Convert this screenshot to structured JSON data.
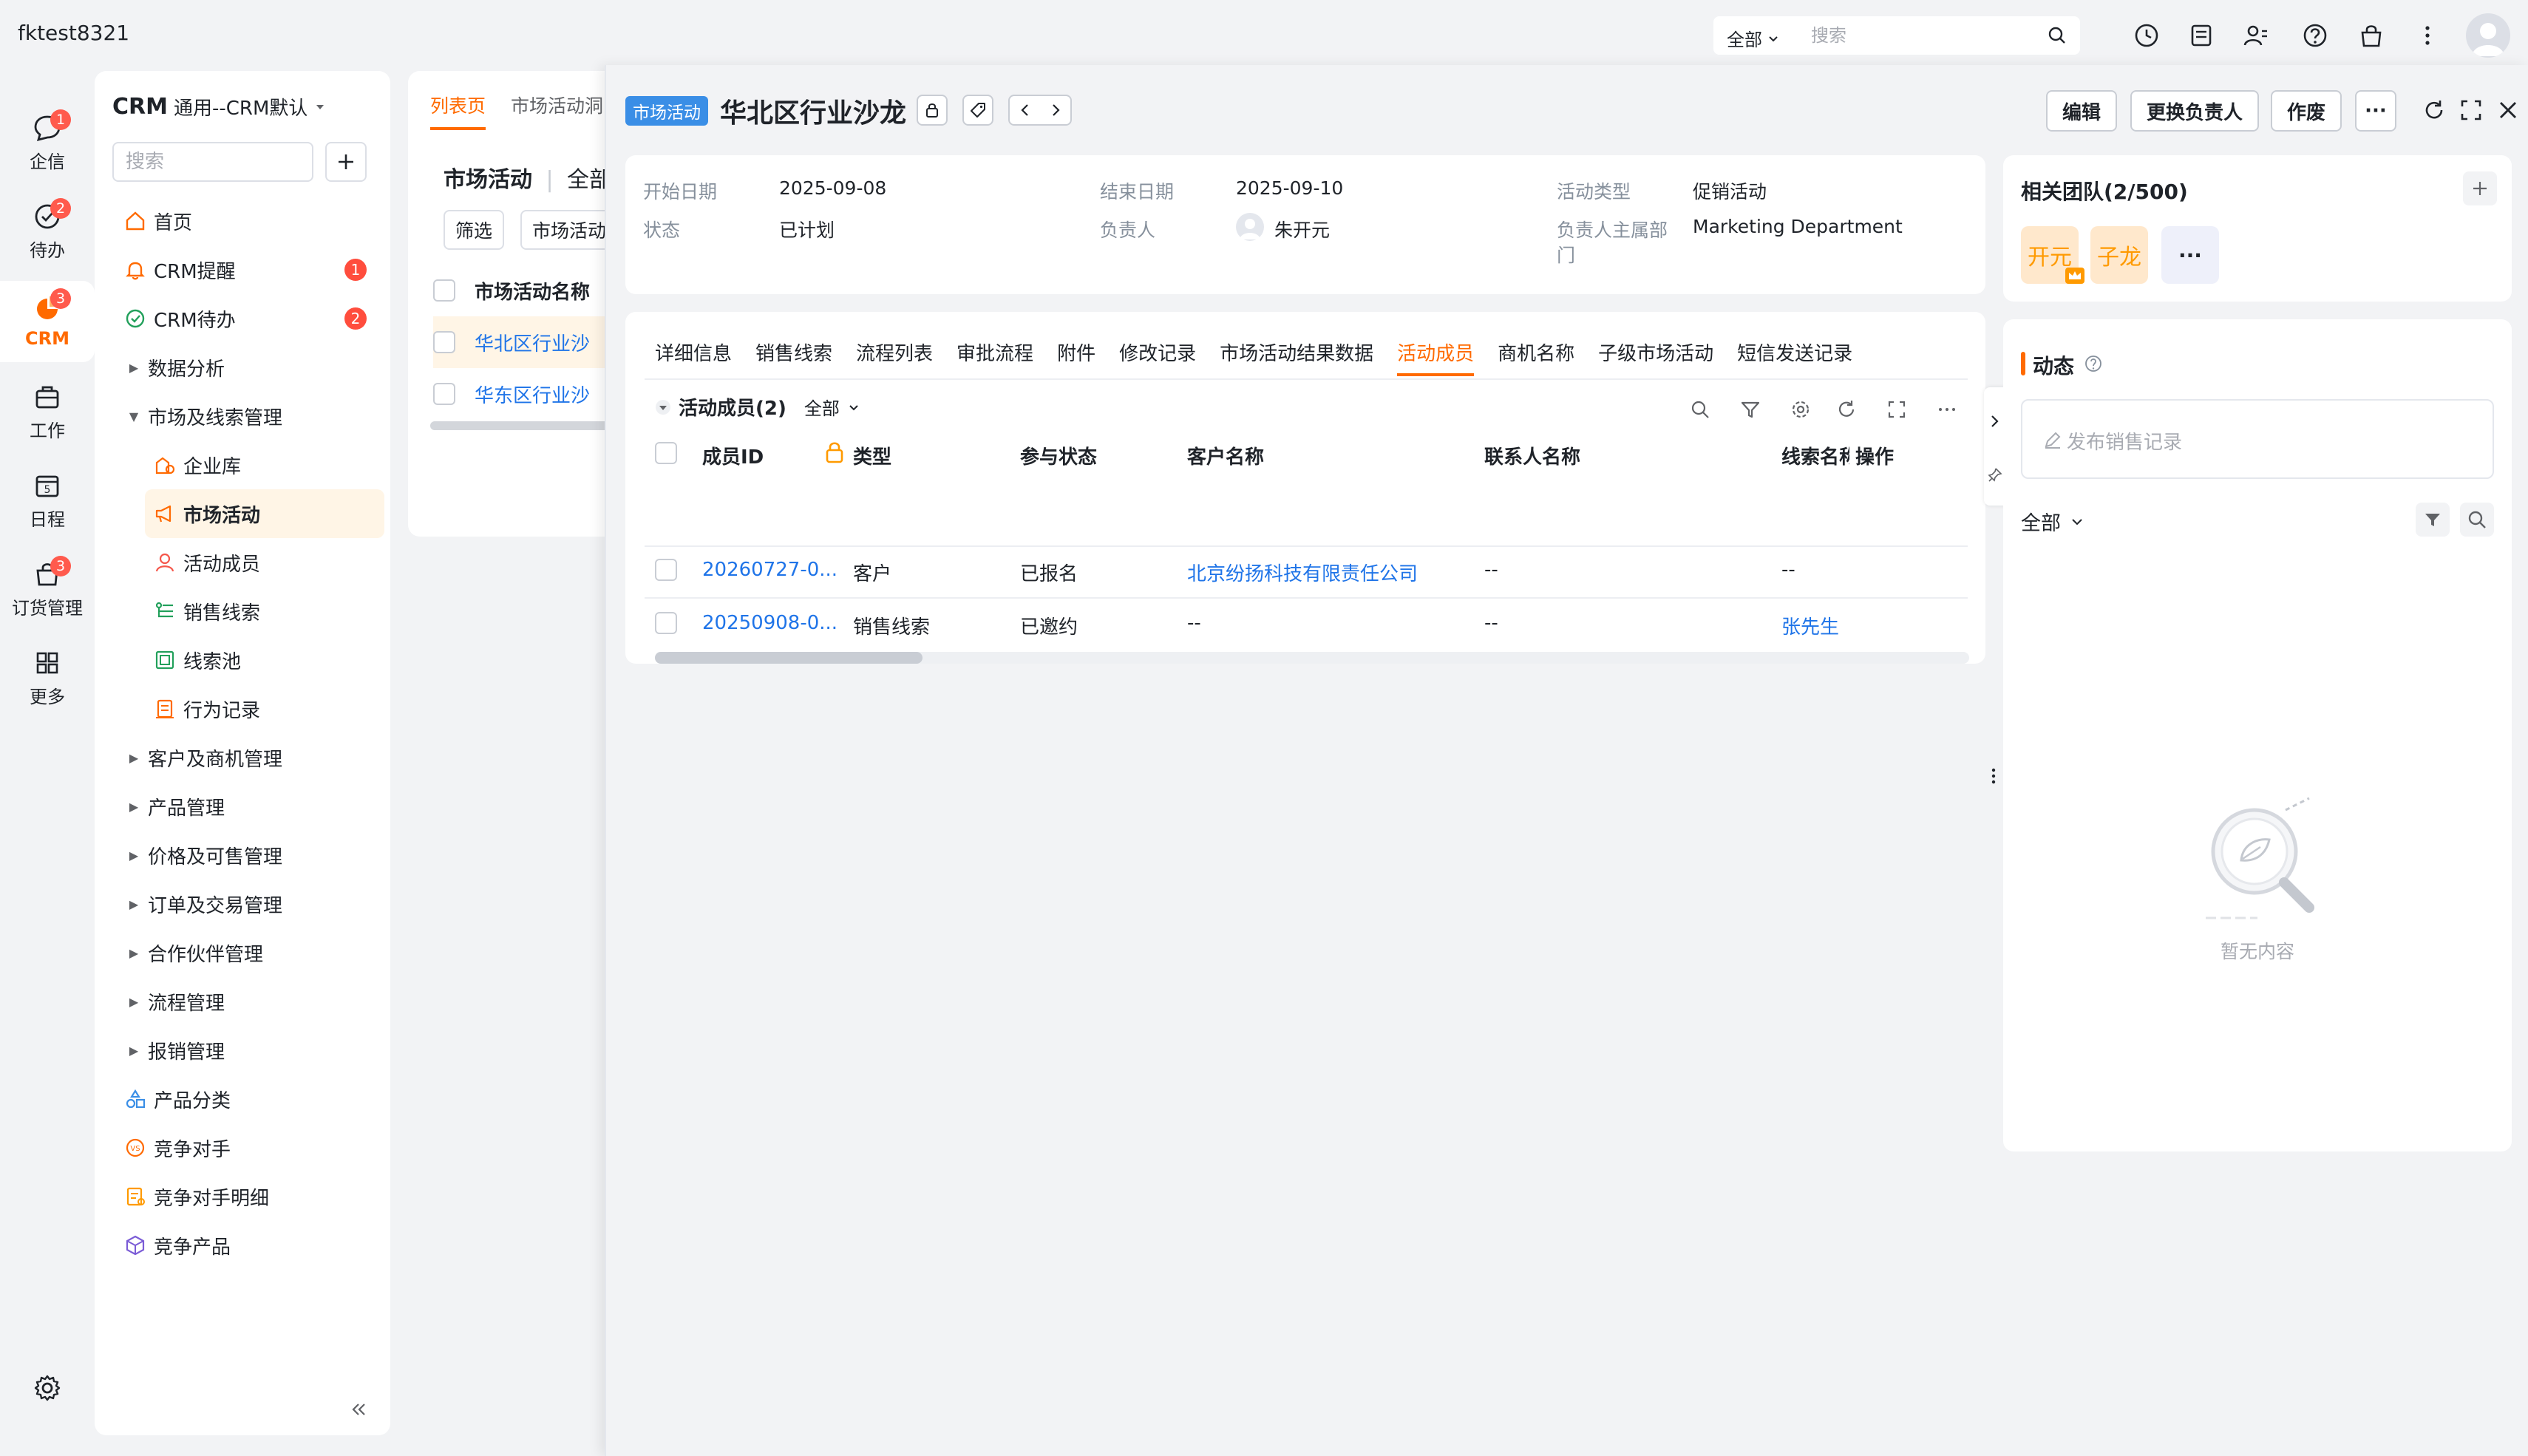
{
  "app": {
    "title": "fktest8321"
  },
  "global_search": {
    "scope": "全部",
    "placeholder": "搜索"
  },
  "top_icons": [
    "clock-icon",
    "notes-icon",
    "contacts-icon",
    "help-icon",
    "bag-icon",
    "more-vertical-icon"
  ],
  "rail": {
    "items": [
      {
        "label": "企信",
        "badge": "1"
      },
      {
        "label": "待办",
        "badge": "2"
      },
      {
        "label": "CRM",
        "badge": "3"
      },
      {
        "label": "工作",
        "badge": ""
      },
      {
        "label": "日程",
        "badge": ""
      },
      {
        "label": "订货管理",
        "badge": "3"
      },
      {
        "label": "更多",
        "badge": ""
      }
    ]
  },
  "sidebar": {
    "title_bold": "CRM",
    "title_rest": "通用--CRM默认",
    "search_placeholder": "搜索",
    "items": [
      {
        "label": "首页",
        "badge": ""
      },
      {
        "label": "CRM提醒",
        "badge": "1"
      },
      {
        "label": "CRM待办",
        "badge": "2"
      },
      {
        "label": "数据分析",
        "badge": ""
      },
      {
        "label": "市场及线索管理",
        "badge": ""
      },
      {
        "label": "企业库",
        "badge": ""
      },
      {
        "label": "市场活动",
        "badge": ""
      },
      {
        "label": "活动成员",
        "badge": ""
      },
      {
        "label": "销售线索",
        "badge": ""
      },
      {
        "label": "线索池",
        "badge": ""
      },
      {
        "label": "行为记录",
        "badge": ""
      },
      {
        "label": "客户及商机管理",
        "badge": ""
      },
      {
        "label": "产品管理",
        "badge": ""
      },
      {
        "label": "价格及可售管理",
        "badge": ""
      },
      {
        "label": "订单及交易管理",
        "badge": ""
      },
      {
        "label": "合作伙伴管理",
        "badge": ""
      },
      {
        "label": "流程管理",
        "badge": ""
      },
      {
        "label": "报销管理",
        "badge": ""
      },
      {
        "label": "产品分类",
        "badge": ""
      },
      {
        "label": "竞争对手",
        "badge": ""
      },
      {
        "label": "竞争对手明细",
        "badge": ""
      },
      {
        "label": "竞争产品",
        "badge": ""
      }
    ]
  },
  "list": {
    "tabs": [
      "列表页",
      "市场活动洞"
    ],
    "heading": "市场活动",
    "heading_scope": "全部",
    "filter_label": "筛选",
    "scene_label": "市场活动",
    "column": "市场活动名称",
    "rows": [
      "华北区行业沙",
      "华东区行业沙"
    ]
  },
  "detail": {
    "module_tag": "市场活动",
    "title": "华北区行业沙龙",
    "actions": {
      "edit": "编辑",
      "change_owner": "更换负责人",
      "void": "作废",
      "more": "···"
    },
    "info": {
      "start_date_label": "开始日期",
      "start_date": "2025-09-08",
      "end_date_label": "结束日期",
      "end_date": "2025-09-10",
      "type_label": "活动类型",
      "type": "促销活动",
      "status_label": "状态",
      "status": "已计划",
      "owner_label": "负责人",
      "owner": "朱开元",
      "dept_label_1": "负责人主属部",
      "dept_label_2": "门",
      "dept": "Marketing Department"
    },
    "tabs": [
      "详细信息",
      "销售线索",
      "流程列表",
      "审批流程",
      "附件",
      "修改记录",
      "市场活动结果数据",
      "活动成员",
      "商机名称",
      "子级市场活动",
      "短信发送记录"
    ],
    "members": {
      "title": "活动成员(2)",
      "scope": "全部",
      "columns": [
        "成员ID",
        "类型",
        "参与状态",
        "客户名称",
        "联系人名称",
        "线索名称",
        "操作"
      ],
      "rows": [
        {
          "id": "20260727-0...",
          "type": "客户",
          "status": "已报名",
          "customer": "北京纷扬科技有限责任公司",
          "contact": "--",
          "lead": "--"
        },
        {
          "id": "20250908-0...",
          "type": "销售线索",
          "status": "已邀约",
          "customer": "--",
          "contact": "--",
          "lead": "张先生"
        }
      ]
    }
  },
  "team": {
    "title": "相关团队(2/500)",
    "members": [
      "开元",
      "子龙"
    ],
    "more": "···"
  },
  "feed": {
    "title": "动态",
    "post_placeholder": "发布销售记录",
    "scope": "全部",
    "empty_text": "暂无内容"
  },
  "colors": {
    "accent": "#ff6a00",
    "link": "#1f74e8",
    "tag_blue": "#3a8ee6",
    "badge_red": "#ff4d3d"
  }
}
